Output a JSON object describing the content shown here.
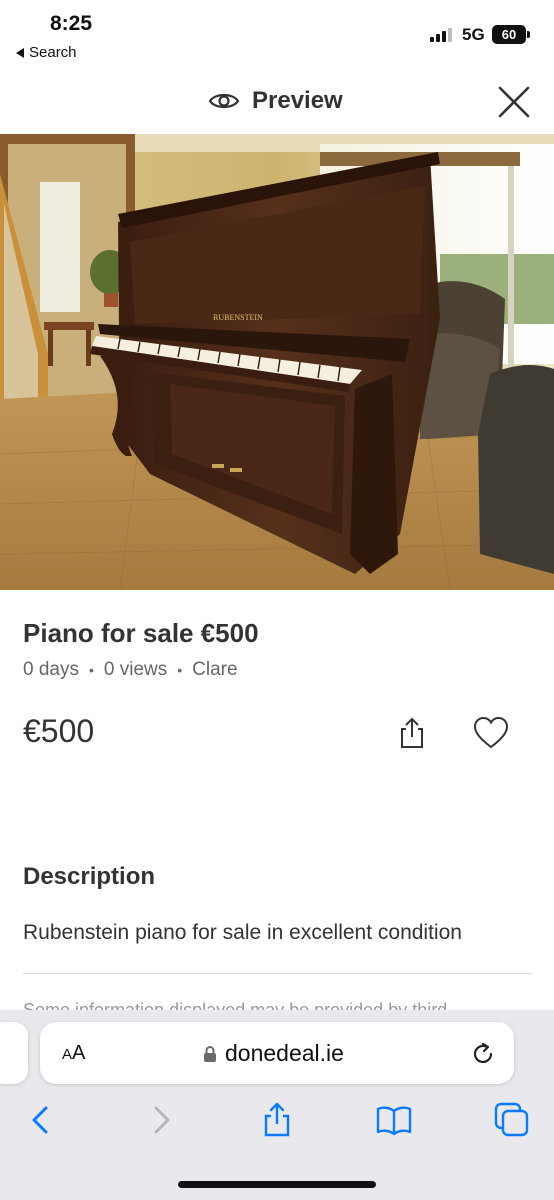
{
  "status": {
    "time": "8:25",
    "back_label": "Search",
    "network": "5G",
    "battery": "60"
  },
  "header": {
    "title": "Preview",
    "icons": {
      "preview": "eye-icon",
      "close": "close-icon"
    }
  },
  "photo": {
    "subject": "piano-photo",
    "brand_plate": "RUBENSTEIN"
  },
  "listing": {
    "title": "Piano for sale €500",
    "meta": {
      "age": "0 days",
      "views": "0 views",
      "location": "Clare"
    },
    "price": "€500",
    "icons": {
      "share": "share-icon",
      "favourite": "heart-icon"
    }
  },
  "description": {
    "heading": "Description",
    "text": "Rubenstein piano for sale in excellent condition",
    "cut_off_text": "Some information displayed may be provided by third"
  },
  "browser": {
    "text_size_label_small": "A",
    "text_size_label_large": "A",
    "domain": "donedeal.ie",
    "icons": {
      "lock": "lock-icon",
      "reload": "reload-icon",
      "back": "chevron-left-icon",
      "forward": "chevron-right-icon",
      "share": "share-icon",
      "bookmarks": "book-icon",
      "tabs": "tabs-icon"
    }
  },
  "colors": {
    "safari_accent": "#0a7aff",
    "toolbar_bg": "#e9e9ed",
    "text_primary": "#333333",
    "text_secondary": "#666666"
  }
}
